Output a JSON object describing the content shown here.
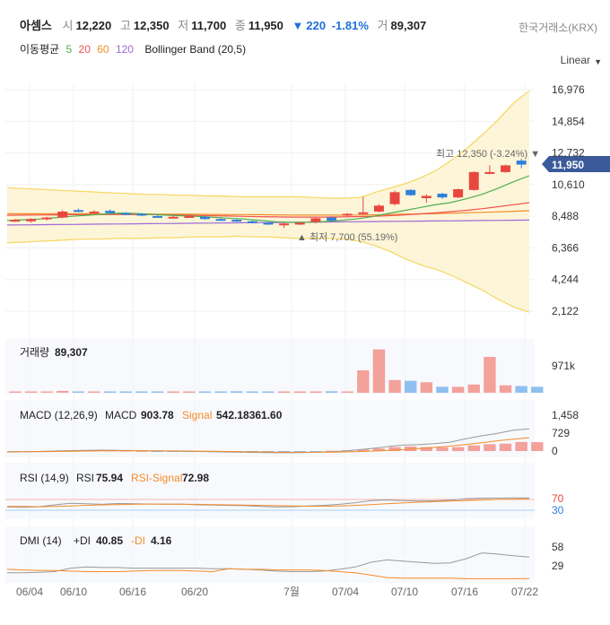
{
  "header": {
    "name": "아셈스",
    "open_label": "시",
    "open": "12,220",
    "high_label": "고",
    "high": "12,350",
    "low_label": "저",
    "low": "11,700",
    "close_label": "종",
    "close": "11,950",
    "change_arrow": "▼",
    "change": "220",
    "change_pct": "-1.81%",
    "volume_label": "거",
    "volume": "89,307",
    "exchange": "한국거래소(KRX)",
    "ma_label": "이동평균",
    "ma_periods": [
      "5",
      "20",
      "60",
      "120"
    ],
    "bb_label": "Bollinger Band (20,5)",
    "scale": "Linear",
    "scale_icon": "chevron-down-icon"
  },
  "colors": {
    "up": "#e8473f",
    "down": "#2f7fd8",
    "ma5": "#4caf50",
    "ma20": "#ef5350",
    "ma60": "#f28c28",
    "ma120": "#9d6ad6",
    "bb_band": "#fdf5d8",
    "bb_line": "#f6d660",
    "last_price_tag": "#3a5a99"
  },
  "annotations": {
    "high_label": "최고 12,350 (-3.24%) ▼",
    "low_label": "▲ 최저 7,700 (55.19%)",
    "last_price": "11,950"
  },
  "chart_data": {
    "type": "candlestick",
    "title": "아셈스",
    "x_ticks": [
      "06/04",
      "06/10",
      "06/16",
      "06/20",
      "7월",
      "07/04",
      "07/10",
      "07/16",
      "07/22"
    ],
    "price_axis": {
      "ticks": [
        "16,976",
        "14,854",
        "12,732",
        "10,610",
        "8,488",
        "6,366",
        "4,244",
        "2,122"
      ],
      "ylim": [
        1700,
        17400
      ]
    },
    "candles": [
      {
        "o": 8200,
        "h": 8300,
        "l": 8100,
        "c": 8250
      },
      {
        "o": 8150,
        "h": 8350,
        "l": 8050,
        "c": 8300
      },
      {
        "o": 8300,
        "h": 8450,
        "l": 8200,
        "c": 8400
      },
      {
        "o": 8400,
        "h": 8900,
        "l": 8350,
        "c": 8800
      },
      {
        "o": 8900,
        "h": 9000,
        "l": 8750,
        "c": 8800
      },
      {
        "o": 8800,
        "h": 8900,
        "l": 8700,
        "c": 8800
      },
      {
        "o": 8850,
        "h": 8950,
        "l": 8650,
        "c": 8700
      },
      {
        "o": 8700,
        "h": 8750,
        "l": 8600,
        "c": 8650
      },
      {
        "o": 8650,
        "h": 8700,
        "l": 8500,
        "c": 8550
      },
      {
        "o": 8500,
        "h": 8550,
        "l": 8400,
        "c": 8450
      },
      {
        "o": 8400,
        "h": 8500,
        "l": 8350,
        "c": 8450
      },
      {
        "o": 8450,
        "h": 8550,
        "l": 8400,
        "c": 8500
      },
      {
        "o": 8450,
        "h": 8500,
        "l": 8250,
        "c": 8300
      },
      {
        "o": 8300,
        "h": 8350,
        "l": 8200,
        "c": 8250
      },
      {
        "o": 8250,
        "h": 8300,
        "l": 8100,
        "c": 8150
      },
      {
        "o": 8150,
        "h": 8200,
        "l": 8000,
        "c": 8050
      },
      {
        "o": 8050,
        "h": 8100,
        "l": 7900,
        "c": 7950
      },
      {
        "o": 7950,
        "h": 8050,
        "l": 7700,
        "c": 8000
      },
      {
        "o": 8000,
        "h": 8100,
        "l": 7900,
        "c": 8050
      },
      {
        "o": 8100,
        "h": 8400,
        "l": 8000,
        "c": 8350
      },
      {
        "o": 8400,
        "h": 8450,
        "l": 8150,
        "c": 8200
      },
      {
        "o": 8550,
        "h": 8700,
        "l": 8450,
        "c": 8650
      },
      {
        "o": 8650,
        "h": 9800,
        "l": 8600,
        "c": 8750
      },
      {
        "o": 8800,
        "h": 9300,
        "l": 8750,
        "c": 9200
      },
      {
        "o": 9300,
        "h": 10200,
        "l": 9200,
        "c": 10100
      },
      {
        "o": 10250,
        "h": 10300,
        "l": 9850,
        "c": 9900
      },
      {
        "o": 9700,
        "h": 9950,
        "l": 9400,
        "c": 9850
      },
      {
        "o": 10000,
        "h": 10050,
        "l": 9650,
        "c": 9750
      },
      {
        "o": 9750,
        "h": 10350,
        "l": 9700,
        "c": 10300
      },
      {
        "o": 10250,
        "h": 11500,
        "l": 10200,
        "c": 11450
      },
      {
        "o": 11400,
        "h": 11900,
        "l": 11300,
        "c": 11450
      },
      {
        "o": 11450,
        "h": 11950,
        "l": 11400,
        "c": 11900
      },
      {
        "o": 12220,
        "h": 12350,
        "l": 11700,
        "c": 11950
      }
    ],
    "ma5": [
      8200,
      8250,
      8300,
      8380,
      8480,
      8550,
      8620,
      8700,
      8680,
      8620,
      8560,
      8520,
      8480,
      8420,
      8360,
      8300,
      8200,
      8120,
      8070,
      8080,
      8130,
      8200,
      8300,
      8450,
      8650,
      8850,
      9050,
      9250,
      9400,
      9650,
      9950,
      10350,
      10800,
      11200
    ],
    "ma20": [
      8550,
      8560,
      8570,
      8580,
      8590,
      8600,
      8600,
      8600,
      8600,
      8600,
      8580,
      8560,
      8540,
      8520,
      8500,
      8480,
      8460,
      8440,
      8430,
      8430,
      8430,
      8440,
      8460,
      8480,
      8520,
      8570,
      8640,
      8710,
      8790,
      8880,
      8990,
      9120,
      9260,
      9400
    ],
    "ma60": [
      8650,
      8650,
      8650,
      8650,
      8650,
      8650,
      8640,
      8640,
      8640,
      8630,
      8630,
      8620,
      8620,
      8610,
      8600,
      8600,
      8590,
      8580,
      8570,
      8560,
      8560,
      8560,
      8570,
      8580,
      8600,
      8620,
      8640,
      8660,
      8690,
      8720,
      8750,
      8780,
      8820,
      8860
    ],
    "ma120": [
      7900,
      7910,
      7920,
      7930,
      7940,
      7950,
      7960,
      7970,
      7980,
      7990,
      8000,
      8010,
      8020,
      8030,
      8040,
      8050,
      8060,
      8070,
      8080,
      8090,
      8100,
      8110,
      8120,
      8130,
      8140,
      8150,
      8160,
      8170,
      8180,
      8190,
      8200,
      8210,
      8220,
      8230
    ],
    "bb_upper": [
      10400,
      10350,
      10300,
      10250,
      10200,
      10150,
      10100,
      10050,
      10000,
      9950,
      9950,
      9900,
      9900,
      9850,
      9850,
      9800,
      9800,
      9800,
      9800,
      9800,
      9750,
      9700,
      9700,
      9750,
      10100,
      10400,
      10700,
      11100,
      11600,
      12300,
      13100,
      14000,
      15000,
      16100,
      16900
    ],
    "bb_lower": [
      6700,
      6750,
      6800,
      6850,
      6900,
      6950,
      6950,
      7000,
      7000,
      7000,
      7050,
      7050,
      7100,
      7100,
      7100,
      7150,
      7100,
      7100,
      7050,
      7000,
      7000,
      7000,
      6950,
      6800,
      6500,
      6100,
      5600,
      5200,
      4900,
      4500,
      4000,
      3500,
      2900,
      2400,
      2050
    ],
    "volume": {
      "label": "거래량",
      "value": "89,307",
      "ticks": [
        "971k"
      ],
      "values": [
        5,
        5,
        5,
        12,
        8,
        4,
        4,
        5,
        6,
        8,
        6,
        7,
        6,
        8,
        10,
        6,
        6,
        7,
        6,
        8,
        10,
        8,
        150,
        290,
        85,
        80,
        70,
        40,
        40,
        55,
        240,
        50,
        45,
        40
      ]
    },
    "macd": {
      "label": "MACD (12,26,9)",
      "macd_label": "MACD",
      "macd_value": "903.78",
      "signal_label": "Signal",
      "signal_value": "542.18361.60",
      "ticks": [
        "1,458",
        "729",
        "0"
      ],
      "macd": [
        -40,
        -30,
        -20,
        0,
        20,
        30,
        35,
        30,
        20,
        10,
        0,
        -10,
        -20,
        -30,
        -40,
        -50,
        -60,
        -70,
        -70,
        -60,
        -40,
        -10,
        40,
        100,
        180,
        240,
        260,
        300,
        360,
        500,
        620,
        720,
        850,
        903
      ],
      "signal": [
        -30,
        -28,
        -25,
        -20,
        -10,
        0,
        10,
        15,
        15,
        12,
        8,
        2,
        -5,
        -12,
        -20,
        -28,
        -36,
        -44,
        -50,
        -52,
        -50,
        -40,
        -25,
        -5,
        20,
        55,
        100,
        150,
        200,
        270,
        340,
        420,
        480,
        542
      ],
      "hist": [
        -10,
        -2,
        5,
        20,
        30,
        30,
        25,
        15,
        5,
        -2,
        -8,
        -12,
        -15,
        -18,
        -20,
        -22,
        -24,
        -26,
        -20,
        -8,
        10,
        30,
        65,
        105,
        160,
        185,
        160,
        150,
        160,
        230,
        280,
        300,
        370,
        361
      ]
    },
    "rsi": {
      "label": "RSI (14,9)",
      "rsi_label": "RSI",
      "rsi_value": "75.94",
      "signal_label": "RSI-Signal",
      "signal_value": "72.98",
      "ticks": [
        "70",
        "30"
      ],
      "rsi": [
        42,
        41,
        43,
        50,
        56,
        54,
        52,
        55,
        54,
        53,
        52,
        53,
        50,
        49,
        48,
        47,
        44,
        42,
        43,
        46,
        48,
        52,
        58,
        66,
        68,
        66,
        64,
        65,
        67,
        73,
        75,
        75,
        76,
        75.94
      ],
      "signal": [
        44,
        44,
        43,
        44,
        46,
        48,
        50,
        51,
        52,
        53,
        53,
        52,
        52,
        51,
        50,
        49,
        48,
        47,
        46,
        45,
        45,
        46,
        48,
        51,
        54,
        57,
        60,
        62,
        64,
        66,
        68,
        70,
        71,
        72.98
      ]
    },
    "dmi": {
      "label": "DMI (14)",
      "plus_label": "+DI",
      "plus_value": "40.85",
      "minus_label": "-DI",
      "minus_value": "4.16",
      "ticks": [
        "58",
        "29"
      ],
      "plus_di": [
        14,
        14,
        15,
        16,
        22,
        24,
        23,
        23,
        22,
        22,
        22,
        22,
        22,
        21,
        21,
        20,
        19,
        17,
        16,
        16,
        17,
        20,
        24,
        32,
        36,
        34,
        32,
        30,
        31,
        38,
        48,
        46,
        43,
        40.85
      ],
      "minus_di": [
        20,
        19,
        18,
        18,
        17,
        16,
        16,
        16,
        17,
        18,
        18,
        18,
        17,
        16,
        21,
        20,
        20,
        19,
        19,
        19,
        18,
        16,
        14,
        10,
        6,
        5,
        5,
        5,
        5,
        4,
        4,
        4,
        4,
        4.16
      ]
    }
  }
}
